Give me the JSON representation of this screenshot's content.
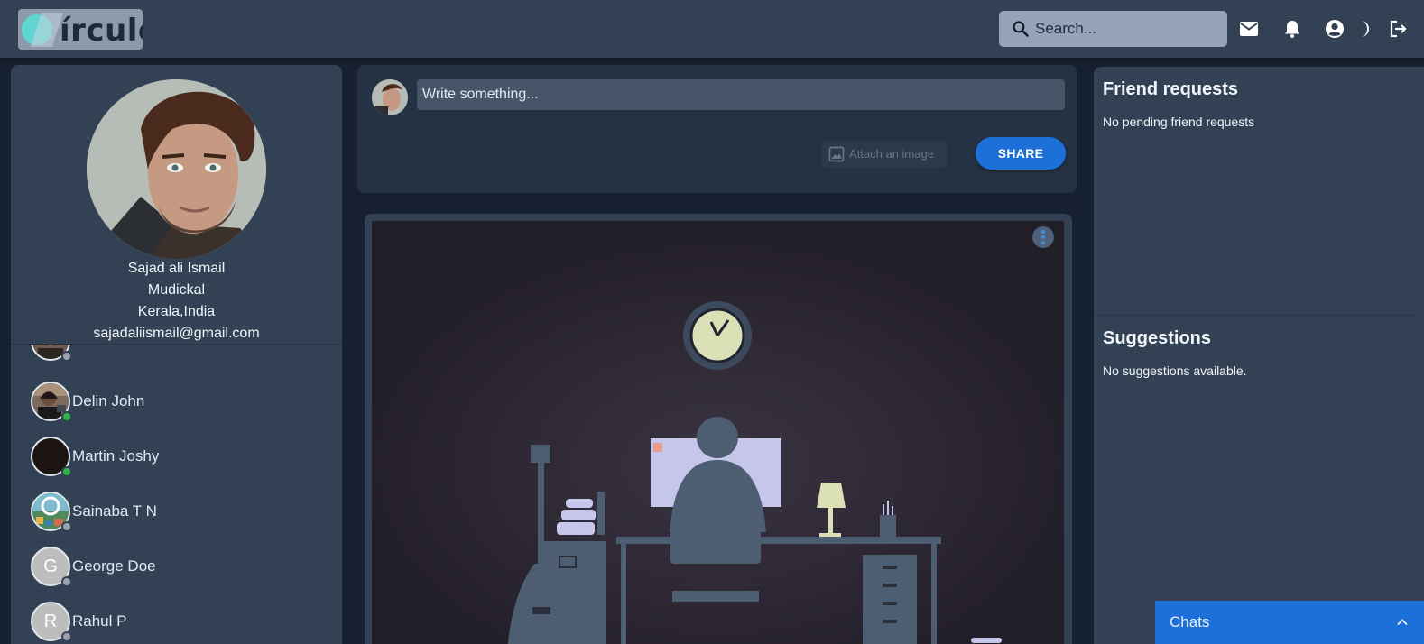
{
  "app": {
    "logo_text": "írculo",
    "logo_image": "circulo-logo"
  },
  "header": {
    "search_placeholder": "Search...",
    "icons": [
      "mail-icon",
      "bell-icon",
      "account-circle-icon",
      "dark-mode-icon",
      "logout-icon"
    ]
  },
  "profile": {
    "name": "Sajad ali Ismail",
    "location_line1": "Mudickal",
    "location_line2": "Kerala,India",
    "email": "sajadaliismail@gmail.com"
  },
  "friends": [
    {
      "name": "",
      "status": "offline",
      "avatar": "photo"
    },
    {
      "name": "Delin John",
      "status": "online",
      "avatar": "photo"
    },
    {
      "name": "Martin Joshy",
      "status": "online",
      "avatar": "dark"
    },
    {
      "name": "Sainaba T N",
      "status": "offline",
      "avatar": "scenery"
    },
    {
      "name": "George Doe",
      "status": "offline",
      "avatar": "G"
    },
    {
      "name": "Rahul P",
      "status": "offline",
      "avatar": "R"
    }
  ],
  "status_colors": {
    "online": "#2fb344",
    "offline": "#9ca3af"
  },
  "composer": {
    "placeholder": "Write something...",
    "attach_label": "Attach an image",
    "share_label": "SHARE"
  },
  "post": {
    "image": "illustration-person-at-desk-night"
  },
  "friend_requests": {
    "title": "Friend requests",
    "empty_text": "No pending friend requests"
  },
  "suggestions": {
    "title": "Suggestions",
    "empty_text": "No suggestions available."
  },
  "chats": {
    "label": "Chats"
  },
  "colors": {
    "accent": "#1d70d8",
    "panel": "#334155",
    "background": "#172030"
  }
}
